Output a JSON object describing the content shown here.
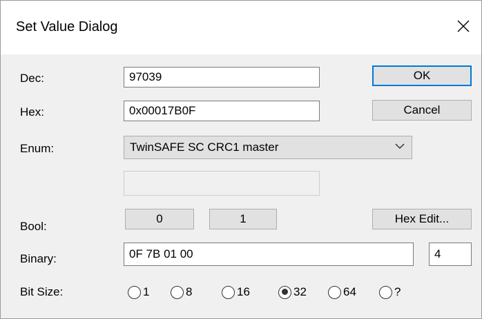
{
  "window": {
    "title": "Set Value Dialog",
    "close_icon": "close-icon"
  },
  "labels": {
    "dec": "Dec:",
    "hex": "Hex:",
    "enum": "Enum:",
    "bool": "Bool:",
    "binary": "Binary:",
    "bit_size": "Bit Size:"
  },
  "fields": {
    "dec_value": "97039",
    "hex_value": "0x00017B0F",
    "enum_selected": "TwinSAFE SC CRC1 master",
    "enum_extra": "",
    "binary_value": "0F 7B 01 00",
    "byte_count": "4"
  },
  "buttons": {
    "ok": "OK",
    "cancel": "Cancel",
    "bool_false": "0",
    "bool_true": "1",
    "hex_edit": "Hex Edit..."
  },
  "bit_sizes": {
    "options": [
      "1",
      "8",
      "16",
      "32",
      "64",
      "?"
    ],
    "selected": "32"
  },
  "colors": {
    "accent": "#0078d7",
    "button_face": "#e1e1e1",
    "dialog_background": "#f0f0f0"
  }
}
